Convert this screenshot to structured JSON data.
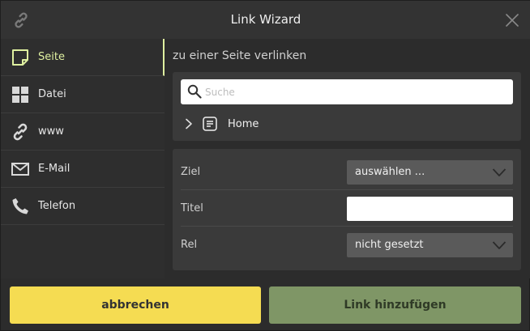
{
  "dialog": {
    "title": "Link Wizard",
    "icons": {
      "logo": "link-icon",
      "close": "close-icon"
    }
  },
  "sidebar": {
    "items": [
      {
        "label": "Seite",
        "icon": "page-icon",
        "active": true
      },
      {
        "label": "Datei",
        "icon": "grid-icon",
        "active": false
      },
      {
        "label": "www",
        "icon": "link-icon",
        "active": false
      },
      {
        "label": "E-Mail",
        "icon": "mail-icon",
        "active": false
      },
      {
        "label": "Telefon",
        "icon": "phone-icon",
        "active": false
      }
    ]
  },
  "main": {
    "heading": "zu einer Seite verlinken",
    "search": {
      "placeholder": "Suche",
      "value": ""
    },
    "tree": [
      {
        "label": "Home",
        "icon": "document-icon",
        "expanded": false
      }
    ],
    "form": {
      "ziel": {
        "label": "Ziel",
        "value": "auswählen ..."
      },
      "titel": {
        "label": "Titel",
        "value": ""
      },
      "rel": {
        "label": "Rel",
        "value": "nicht gesetzt"
      }
    }
  },
  "footer": {
    "cancel_label": "abbrechen",
    "add_label": "Link hinzufügen"
  },
  "colors": {
    "accent": "#dff0a0",
    "cancel_bg": "#f5dc52",
    "add_bg": "#7f9666",
    "panel_bg": "#3a3a3a",
    "select_bg": "#5a5a5a"
  }
}
